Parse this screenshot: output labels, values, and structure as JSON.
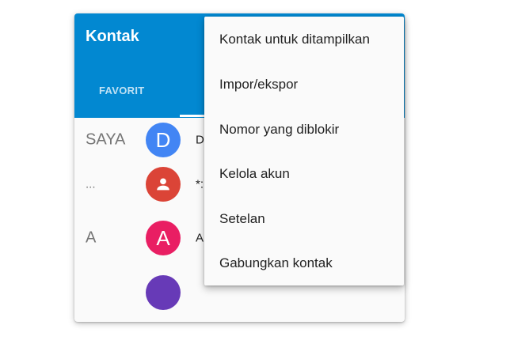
{
  "app": {
    "title": "Kontak",
    "tabs": [
      "FAVORIT"
    ],
    "accent_color": "#0288d1"
  },
  "contacts": [
    {
      "section": "SAYA",
      "initial": "D",
      "name": "D",
      "avatar_color": "#4285f4"
    },
    {
      "section": "...",
      "initial": "person-icon",
      "name": "*:",
      "avatar_color": "#db4437"
    },
    {
      "section": "A",
      "initial": "A",
      "name": "A",
      "avatar_color": "#e91e63"
    },
    {
      "section": "",
      "initial": "",
      "name": "",
      "avatar_color": "#673ab7"
    }
  ],
  "overflow_menu": {
    "items": [
      "Kontak untuk ditampilkan",
      "Impor/ekspor",
      "Nomor yang diblokir",
      "Kelola akun",
      "Setelan",
      "Gabungkan kontak"
    ]
  }
}
